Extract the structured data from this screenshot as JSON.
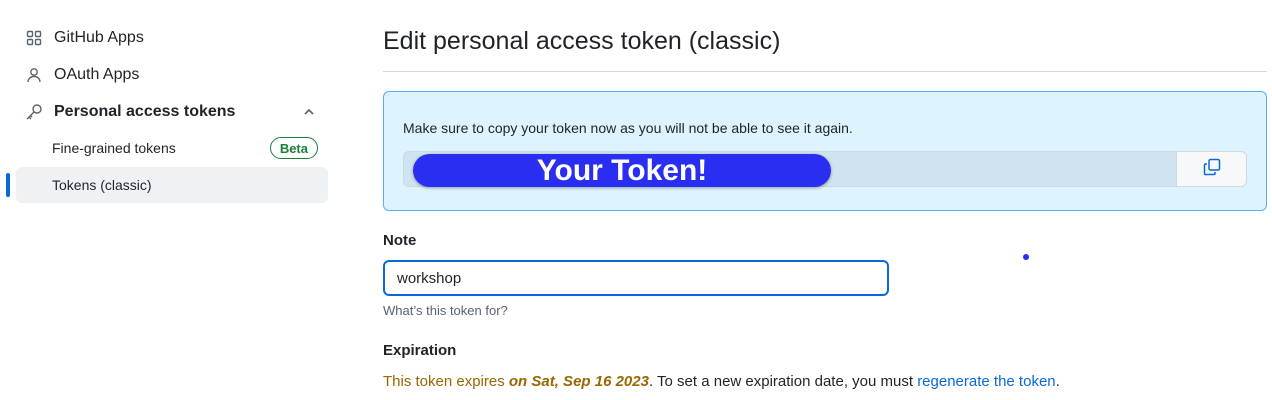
{
  "sidebar": {
    "items": [
      {
        "label": "GitHub Apps",
        "icon": "apps-grid-icon"
      },
      {
        "label": "OAuth Apps",
        "icon": "person-icon"
      },
      {
        "label": "Personal access tokens",
        "icon": "key-icon",
        "expanded": true
      }
    ],
    "sub_items": [
      {
        "label": "Fine-grained tokens",
        "badge": "Beta"
      },
      {
        "label": "Tokens (classic)",
        "active": true
      }
    ]
  },
  "main": {
    "title": "Edit personal access token (classic)",
    "flash": {
      "message": "Make sure to copy your token now as you will not be able to see it again.",
      "token_overlay": "Your Token!",
      "copy_icon": "copy-icon"
    },
    "note": {
      "label": "Note",
      "value": "workshop",
      "hint": "What’s this token for?"
    },
    "expiration": {
      "label": "Expiration",
      "text_before": "This token expires ",
      "date": "on Sat, Sep 16 2023",
      "text_middle": ". To set a new expiration date, you must ",
      "link": "regenerate the token",
      "text_after": "."
    }
  },
  "colors": {
    "accent": "#0969da",
    "flash_bg": "#ddf4ff",
    "warning": "#9a6700",
    "success": "#1a7f37",
    "token_overlay": "#2a2ef0"
  }
}
